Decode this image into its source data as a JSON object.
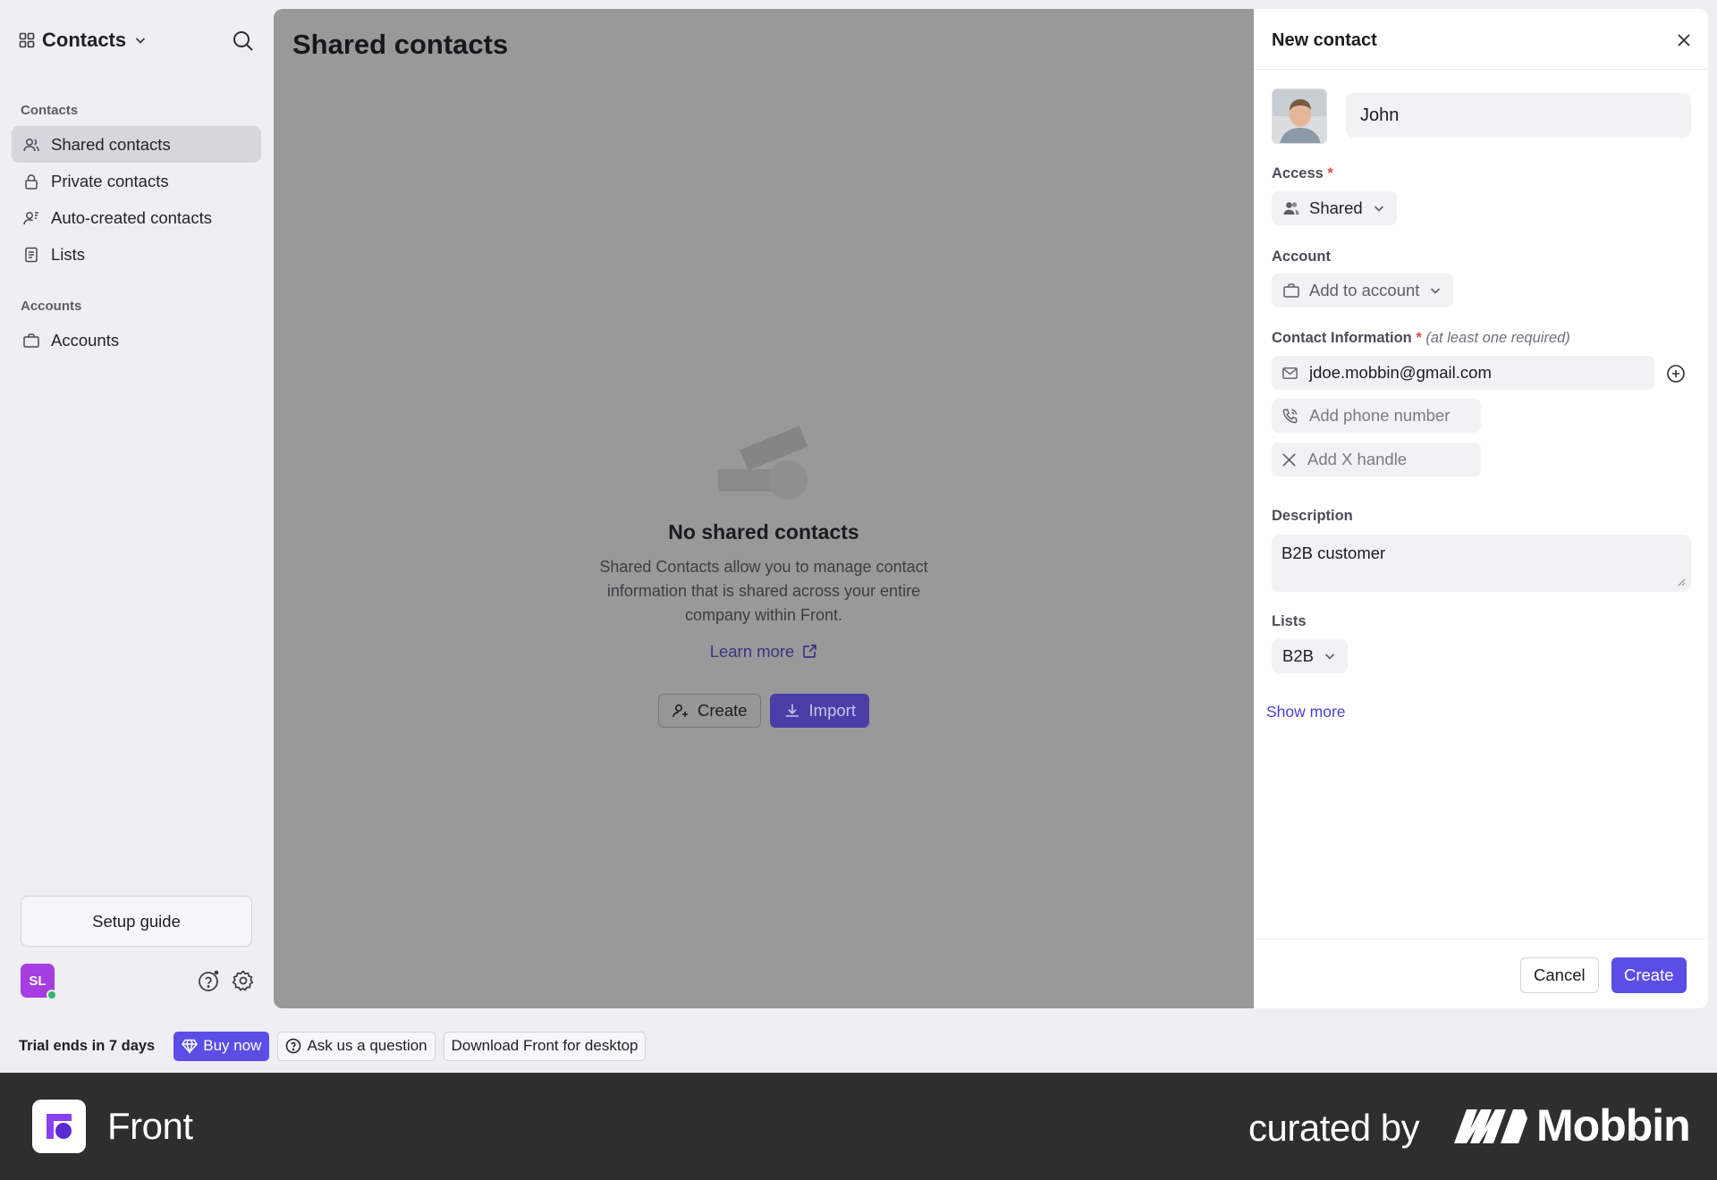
{
  "sidebar": {
    "app_name": "Contacts",
    "sections": [
      {
        "label": "Contacts"
      },
      {
        "label": "Accounts"
      }
    ],
    "items": [
      {
        "label": "Shared contacts",
        "active": true,
        "icon": "users-icon"
      },
      {
        "label": "Private contacts",
        "active": false,
        "icon": "lock-icon"
      },
      {
        "label": "Auto-created contacts",
        "active": false,
        "icon": "user-auto-icon"
      },
      {
        "label": "Lists",
        "active": false,
        "icon": "list-icon"
      },
      {
        "label": "Accounts",
        "active": false,
        "icon": "briefcase-icon"
      }
    ],
    "setup_guide": "Setup guide",
    "user_initials": "SL"
  },
  "main": {
    "title": "Shared contacts",
    "empty": {
      "title": "No shared contacts",
      "description": "Shared Contacts allow you to manage contact information that is shared across your entire company within Front.",
      "learn_more": "Learn more",
      "create_label": "Create",
      "import_label": "Import"
    }
  },
  "panel": {
    "title": "New contact",
    "name_value": "John",
    "access": {
      "label": "Access",
      "required_mark": "*",
      "value": "Shared"
    },
    "account": {
      "label": "Account",
      "placeholder": "Add to account"
    },
    "contact_info": {
      "label": "Contact Information",
      "required_mark": "*",
      "hint": "(at least one required)",
      "email": "jdoe.mobbin@gmail.com",
      "phone_placeholder": "Add phone number",
      "x_placeholder": "Add X handle"
    },
    "description": {
      "label": "Description",
      "value": "B2B customer"
    },
    "lists": {
      "label": "Lists",
      "value": "B2B"
    },
    "show_more": "Show more",
    "cancel": "Cancel",
    "create": "Create"
  },
  "trial_bar": {
    "text": "Trial ends in 7 days",
    "buy_now": "Buy now",
    "ask": "Ask us a question",
    "download": "Download Front for desktop"
  },
  "footer": {
    "brand": "Front",
    "curated_by": "curated by",
    "curator": "Mobbin"
  },
  "colors": {
    "accent": "#5b4ee6",
    "overlay": "#999999",
    "avatar": "#a53de0",
    "online": "#2fb86a",
    "required": "#e5484d"
  }
}
